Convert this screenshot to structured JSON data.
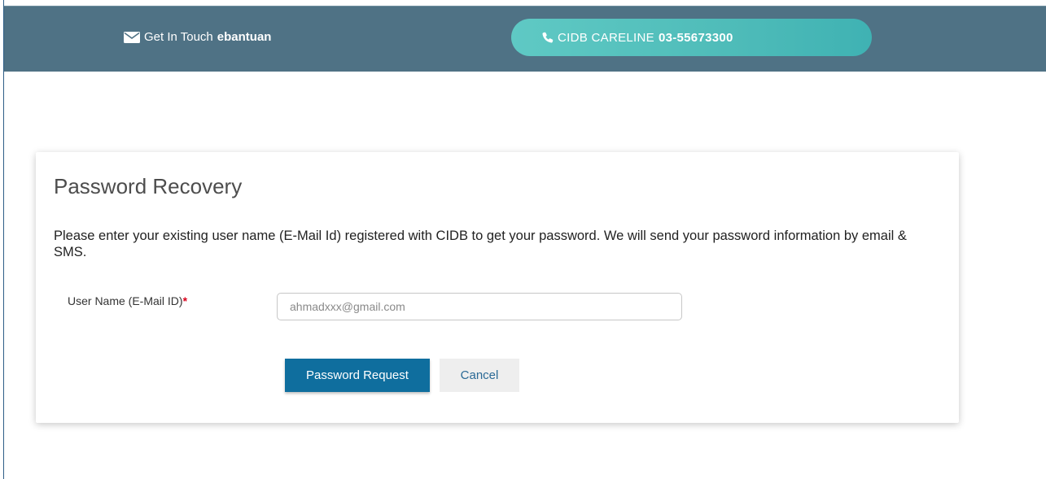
{
  "header": {
    "contact_prefix": "Get In Touch",
    "contact_name": "ebantuan",
    "contact_icon": "mail-icon",
    "careline_prefix": "CIDB CARELINE",
    "careline_number": "03-55673300",
    "careline_icon": "phone-icon",
    "colors": {
      "topbar": "#4f7285",
      "careline_pill": "#4fbcb9"
    }
  },
  "recovery": {
    "title": "Password Recovery",
    "description": "Please enter your existing user name (E-Mail Id) registered with CIDB to get your password. We will send your password information by email & SMS.",
    "username_label": "User Name (E-Mail ID)",
    "required_marker": "*",
    "username_value": "",
    "username_placeholder": "ahmadxxx@gmail.com",
    "submit_label": "Password Request",
    "cancel_label": "Cancel",
    "colors": {
      "submit_button": "#0f6e9e",
      "required_marker": "#d9001b"
    }
  }
}
